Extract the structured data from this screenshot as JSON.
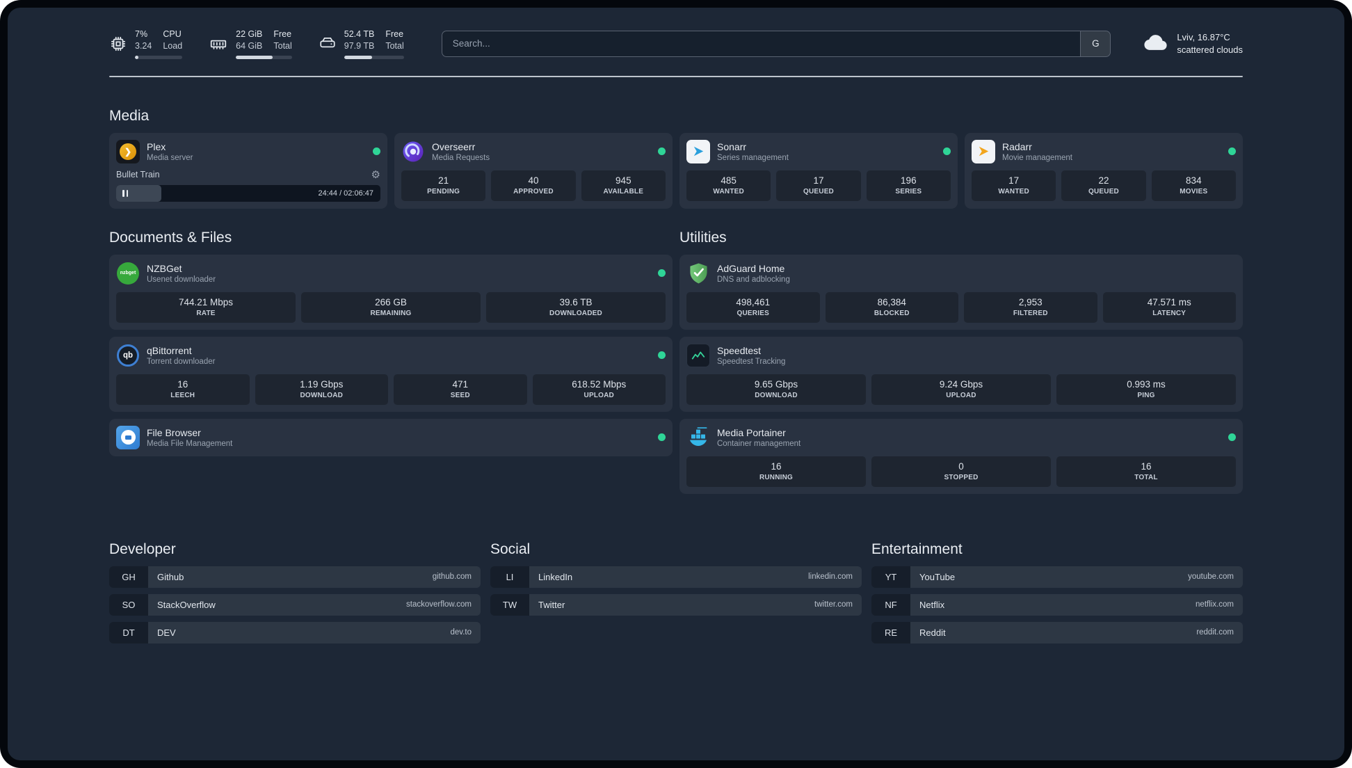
{
  "header": {
    "cpu": {
      "value_top": "7%",
      "value_bottom": "3.24",
      "label_top": "CPU",
      "label_bottom": "Load",
      "progress": 7
    },
    "memory": {
      "value_top": "22 GiB",
      "value_bottom": "64 GiB",
      "label_top": "Free",
      "label_bottom": "Total",
      "progress": 66
    },
    "disk": {
      "value_top": "52.4 TB",
      "value_bottom": "97.9 TB",
      "label_top": "Free",
      "label_bottom": "Total",
      "progress": 47
    },
    "search": {
      "placeholder": "Search...",
      "button_label": "G"
    },
    "weather": {
      "location": "Lviv, 16.87°C",
      "condition": "scattered clouds"
    }
  },
  "sections": {
    "media": {
      "title": "Media"
    },
    "documents": {
      "title": "Documents & Files"
    },
    "utilities": {
      "title": "Utilities"
    }
  },
  "services": {
    "plex": {
      "title": "Plex",
      "subtitle": "Media server",
      "now_playing": "Bullet Train",
      "time": "24:44 / 02:06:47",
      "progress_percent": 17
    },
    "overseerr": {
      "title": "Overseerr",
      "subtitle": "Media Requests",
      "stats": [
        {
          "value": "21",
          "label": "PENDING"
        },
        {
          "value": "40",
          "label": "APPROVED"
        },
        {
          "value": "945",
          "label": "AVAILABLE"
        }
      ]
    },
    "sonarr": {
      "title": "Sonarr",
      "subtitle": "Series management",
      "stats": [
        {
          "value": "485",
          "label": "WANTED"
        },
        {
          "value": "17",
          "label": "QUEUED"
        },
        {
          "value": "196",
          "label": "SERIES"
        }
      ]
    },
    "radarr": {
      "title": "Radarr",
      "subtitle": "Movie management",
      "stats": [
        {
          "value": "17",
          "label": "WANTED"
        },
        {
          "value": "22",
          "label": "QUEUED"
        },
        {
          "value": "834",
          "label": "MOVIES"
        }
      ]
    },
    "nzbget": {
      "title": "NZBGet",
      "subtitle": "Usenet downloader",
      "stats": [
        {
          "value": "744.21 Mbps",
          "label": "RATE"
        },
        {
          "value": "266 GB",
          "label": "REMAINING"
        },
        {
          "value": "39.6 TB",
          "label": "DOWNLOADED"
        }
      ]
    },
    "qbittorrent": {
      "title": "qBittorrent",
      "subtitle": "Torrent downloader",
      "stats": [
        {
          "value": "16",
          "label": "LEECH"
        },
        {
          "value": "1.19 Gbps",
          "label": "DOWNLOAD"
        },
        {
          "value": "471",
          "label": "SEED"
        },
        {
          "value": "618.52 Mbps",
          "label": "UPLOAD"
        }
      ]
    },
    "filebrowser": {
      "title": "File Browser",
      "subtitle": "Media File Management"
    },
    "adguard": {
      "title": "AdGuard Home",
      "subtitle": "DNS and adblocking",
      "stats": [
        {
          "value": "498,461",
          "label": "QUERIES"
        },
        {
          "value": "86,384",
          "label": "BLOCKED"
        },
        {
          "value": "2,953",
          "label": "FILTERED"
        },
        {
          "value": "47.571 ms",
          "label": "LATENCY"
        }
      ]
    },
    "speedtest": {
      "title": "Speedtest",
      "subtitle": "Speedtest Tracking",
      "stats": [
        {
          "value": "9.65 Gbps",
          "label": "DOWNLOAD"
        },
        {
          "value": "9.24 Gbps",
          "label": "UPLOAD"
        },
        {
          "value": "0.993 ms",
          "label": "PING"
        }
      ]
    },
    "portainer": {
      "title": "Media Portainer",
      "subtitle": "Container management",
      "stats": [
        {
          "value": "16",
          "label": "RUNNING"
        },
        {
          "value": "0",
          "label": "STOPPED"
        },
        {
          "value": "16",
          "label": "TOTAL"
        }
      ]
    }
  },
  "bookmarks": {
    "developer": {
      "title": "Developer",
      "items": [
        {
          "abbr": "GH",
          "name": "Github",
          "href": "github.com"
        },
        {
          "abbr": "SO",
          "name": "StackOverflow",
          "href": "stackoverflow.com"
        },
        {
          "abbr": "DT",
          "name": "DEV",
          "href": "dev.to"
        }
      ]
    },
    "social": {
      "title": "Social",
      "items": [
        {
          "abbr": "LI",
          "name": "LinkedIn",
          "href": "linkedin.com"
        },
        {
          "abbr": "TW",
          "name": "Twitter",
          "href": "twitter.com"
        }
      ]
    },
    "entertainment": {
      "title": "Entertainment",
      "items": [
        {
          "abbr": "YT",
          "name": "YouTube",
          "href": "youtube.com"
        },
        {
          "abbr": "NF",
          "name": "Netflix",
          "href": "netflix.com"
        },
        {
          "abbr": "RE",
          "name": "Reddit",
          "href": "reddit.com"
        }
      ]
    }
  },
  "colors": {
    "status_green": "#2fd597",
    "background": "#1d2736"
  }
}
